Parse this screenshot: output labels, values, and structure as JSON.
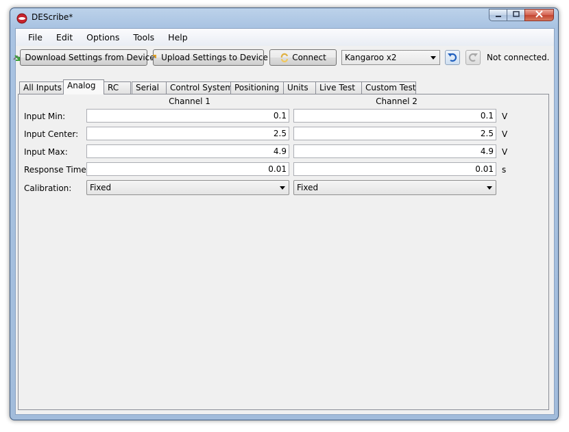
{
  "window": {
    "title": "DEScribe*"
  },
  "menu": [
    "File",
    "Edit",
    "Options",
    "Tools",
    "Help"
  ],
  "toolbar": {
    "download_label": "Download Settings from Device",
    "upload_label": "Upload Settings to Device",
    "connect_label": "Connect",
    "device": "Kangaroo x2",
    "status": "Not connected."
  },
  "tabs": [
    "All Inputs",
    "Analog",
    "RC",
    "Serial",
    "Control System",
    "Positioning",
    "Units",
    "Live Test",
    "Custom Test"
  ],
  "active_tab": "Analog",
  "analog": {
    "channel1_header": "Channel 1",
    "channel2_header": "Channel 2",
    "rows": [
      {
        "label": "Input Min:",
        "ch1": "0.1",
        "ch2": "0.1",
        "unit": "V"
      },
      {
        "label": "Input Center:",
        "ch1": "2.5",
        "ch2": "2.5",
        "unit": "V"
      },
      {
        "label": "Input Max:",
        "ch1": "4.9",
        "ch2": "4.9",
        "unit": "V"
      },
      {
        "label": "Response Time:",
        "ch1": "0.01",
        "ch2": "0.01",
        "unit": "s"
      }
    ],
    "calibration_label": "Calibration:",
    "calibration_ch1": "Fixed",
    "calibration_ch2": "Fixed"
  },
  "colors": {
    "title_bar": "#a9c3e2",
    "close_button": "#c24431",
    "client_bg": "#f0f0f0"
  },
  "icons": [
    "app-logo-icon",
    "minimize-icon",
    "maximize-icon",
    "close-icon",
    "download-icon",
    "upload-icon",
    "connect-icon",
    "undo-icon",
    "redo-icon"
  ]
}
